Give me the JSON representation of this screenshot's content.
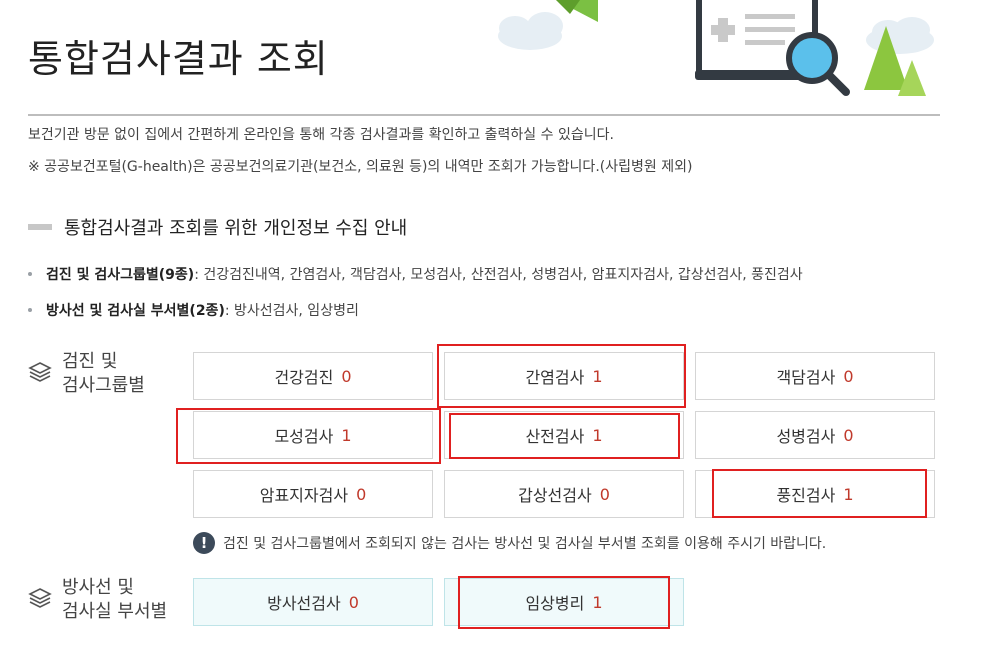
{
  "page": {
    "title": "통합검사결과 조회",
    "desc1": "보건기관 방문 없이 집에서 간편하게 온라인을 통해 각종 검사결과를 확인하고 출력하실 수 있습니다.",
    "desc2": "※ 공공보건포털(G-health)은 공공보건의료기관(보건소, 의료원 등)의 내역만 조회가 가능합니다.(사립병원 제외)"
  },
  "section": {
    "heading": "통합검사결과 조회를 위한 개인정보 수집 안내",
    "bullet1_label": "검진 및 검사그룹별(9종)",
    "bullet1_text": " : 건강검진내역, 간염검사, 객담검사, 모성검사, 산전검사, 성병검사, 암표지자검사, 갑상선검사, 풍진검사",
    "bullet2_label": "방사선 및 검사실 부서별(2종)",
    "bullet2_text": " : 방사선검사, 임상병리"
  },
  "group1": {
    "label_line1": "검진 및",
    "label_line2": "검사그룹별",
    "tiles": [
      {
        "name": "건강검진",
        "count": "0"
      },
      {
        "name": "간염검사",
        "count": "1"
      },
      {
        "name": "객담검사",
        "count": "0"
      },
      {
        "name": "모성검사",
        "count": "1"
      },
      {
        "name": "산전검사",
        "count": "1"
      },
      {
        "name": "성병검사",
        "count": "0"
      },
      {
        "name": "암표지자검사",
        "count": "0"
      },
      {
        "name": "갑상선검사",
        "count": "0"
      },
      {
        "name": "풍진검사",
        "count": "1"
      }
    ]
  },
  "notice": {
    "icon": "!",
    "text": "검진 및 검사그룹별에서 조회되지 않는 검사는 방사선 및 검사실 부서별 조회를 이용해 주시기 바랍니다."
  },
  "group2": {
    "label_line1": "방사선 및",
    "label_line2": "검사실 부서별",
    "tiles": [
      {
        "name": "방사선검사",
        "count": "0"
      },
      {
        "name": "임상병리",
        "count": "1"
      }
    ]
  },
  "colors": {
    "count": "#c0392b",
    "highlight": "#e02020",
    "alt_tile_bg": "#f0fafb",
    "notice_icon_bg": "#3c4a5a"
  },
  "icons": {
    "header": [
      "cloud-icon",
      "paper-plane-icon",
      "medical-document-icon",
      "magnifier-icon",
      "tree-icon"
    ],
    "group": "layers-icon",
    "notice": "exclamation-circle-icon"
  }
}
